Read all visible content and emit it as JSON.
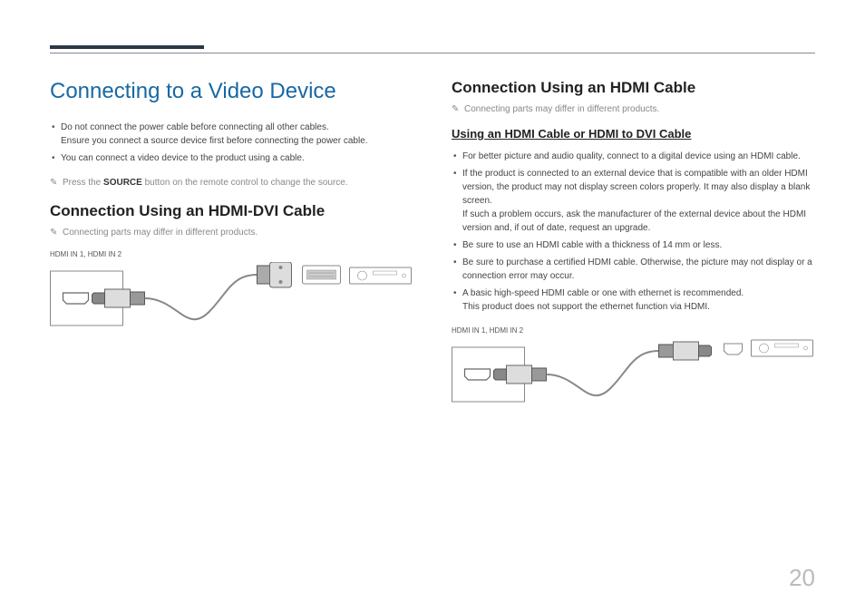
{
  "pageNumber": "20",
  "left": {
    "title": "Connecting to a Video Device",
    "bullets1": [
      "Do not connect the power cable before connecting all other cables.\nEnsure you connect a source device first before connecting the power cable.",
      "You can connect a video device to the product using a cable."
    ],
    "noteSource": "Press the ",
    "noteSourceBtn": "SOURCE",
    "noteSourceAfter": " button on the remote control to change the source.",
    "heading2": "Connection Using an HDMI-DVI Cable",
    "noteDiffer": "Connecting parts may differ in different products.",
    "portLabel": "HDMI IN 1, HDMI IN 2"
  },
  "right": {
    "heading2": "Connection Using an HDMI Cable",
    "noteDiffer": "Connecting parts may differ in different products.",
    "heading3": "Using an HDMI Cable or HDMI to DVI Cable",
    "bullets": [
      "For better picture and audio quality, connect to a digital device using an HDMI cable.",
      "If the product is connected to an external device that is compatible with an older HDMI version, the product may not display screen colors properly. It may also display a blank screen.\nIf such a problem occurs, ask the manufacturer of the external device about the HDMI version and, if out of date, request an upgrade.",
      "Be sure to use an HDMI cable with a thickness of 14 mm or less.",
      "Be sure to purchase a certified HDMI cable. Otherwise, the picture may not display or a connection error may occur.",
      "A basic high-speed HDMI cable or one with ethernet is recommended.\nThis product does not support the ethernet function via HDMI."
    ],
    "portLabel": "HDMI IN 1, HDMI IN 2"
  }
}
